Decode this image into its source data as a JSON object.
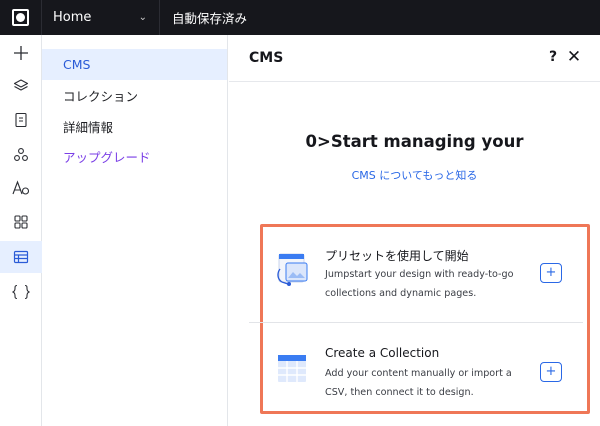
{
  "topbar": {
    "page_name": "Home",
    "save_status": "自動保存済み"
  },
  "rail": {
    "icons": [
      "add-icon",
      "layers-icon",
      "pages-icon",
      "apps-icon",
      "theme-icon",
      "market-icon",
      "cms-icon",
      "code-icon"
    ],
    "active": "cms-icon"
  },
  "subnav": {
    "items": [
      {
        "label": "CMS",
        "active": true
      },
      {
        "label": "コレクション"
      },
      {
        "label": "詳細情報"
      },
      {
        "label": "アップグレード"
      }
    ]
  },
  "panel": {
    "title": "CMS",
    "help_label": "?",
    "close_label": "✕",
    "headline": "0>Start managing your",
    "learn_link": "CMS についてもっと知る",
    "cards": [
      {
        "title": "プリセットを使用して開始",
        "desc_line1": "Jumpstart your design with ready-to-go",
        "desc_line2": "collections and dynamic pages.",
        "add_label": "+",
        "icon": "preset-icon"
      },
      {
        "title": "Create a Collection",
        "desc_line1": "Add your content manually or import a",
        "desc_line2": "CSV, then connect it to design.",
        "add_label": "+",
        "icon": "collection-table-icon"
      }
    ]
  },
  "colors": {
    "accent": "#2a68e6",
    "highlight_border": "#ef7757",
    "upgrade": "#7a3ee6",
    "topbar": "#16171c"
  }
}
